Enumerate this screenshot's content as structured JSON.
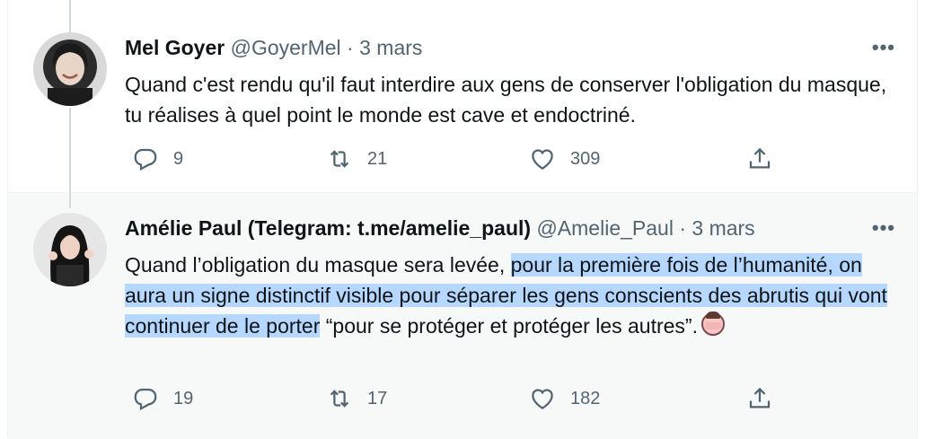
{
  "tweets": [
    {
      "name": "Mel Goyer",
      "handle": "@GoyerMel",
      "separator": "·",
      "date": "3 mars",
      "more": "•••",
      "text": "Quand c'est rendu qu'il faut interdire aux gens de conserver l'obligation du masque, tu réalises à quel point le monde est cave et endoctriné.",
      "replies": "9",
      "retweets": "21",
      "likes": "309"
    },
    {
      "name": "Amélie Paul (Telegram: t.me/amelie_paul)",
      "handle": "@Amelie_Paul",
      "separator": "·",
      "date": "3 mars",
      "more": "•••",
      "text_before": "Quand l’obligation du masque sera levée, ",
      "text_highlight": "pour la première fois de l’humanité, on aura un signe distinctif visible pour séparer les gens conscients des abrutis qui vont continuer de le porter",
      "text_after": " “pour se protéger et protéger les autres”.",
      "emoji": "facepalm-emoji",
      "replies": "19",
      "retweets": "17",
      "likes": "182"
    }
  ],
  "colors": {
    "text": "#0f1419",
    "secondary": "#536471",
    "highlight": "#b6d7ff",
    "thread_line": "#cfd9de",
    "hover_bg": "#f7f9f9"
  }
}
